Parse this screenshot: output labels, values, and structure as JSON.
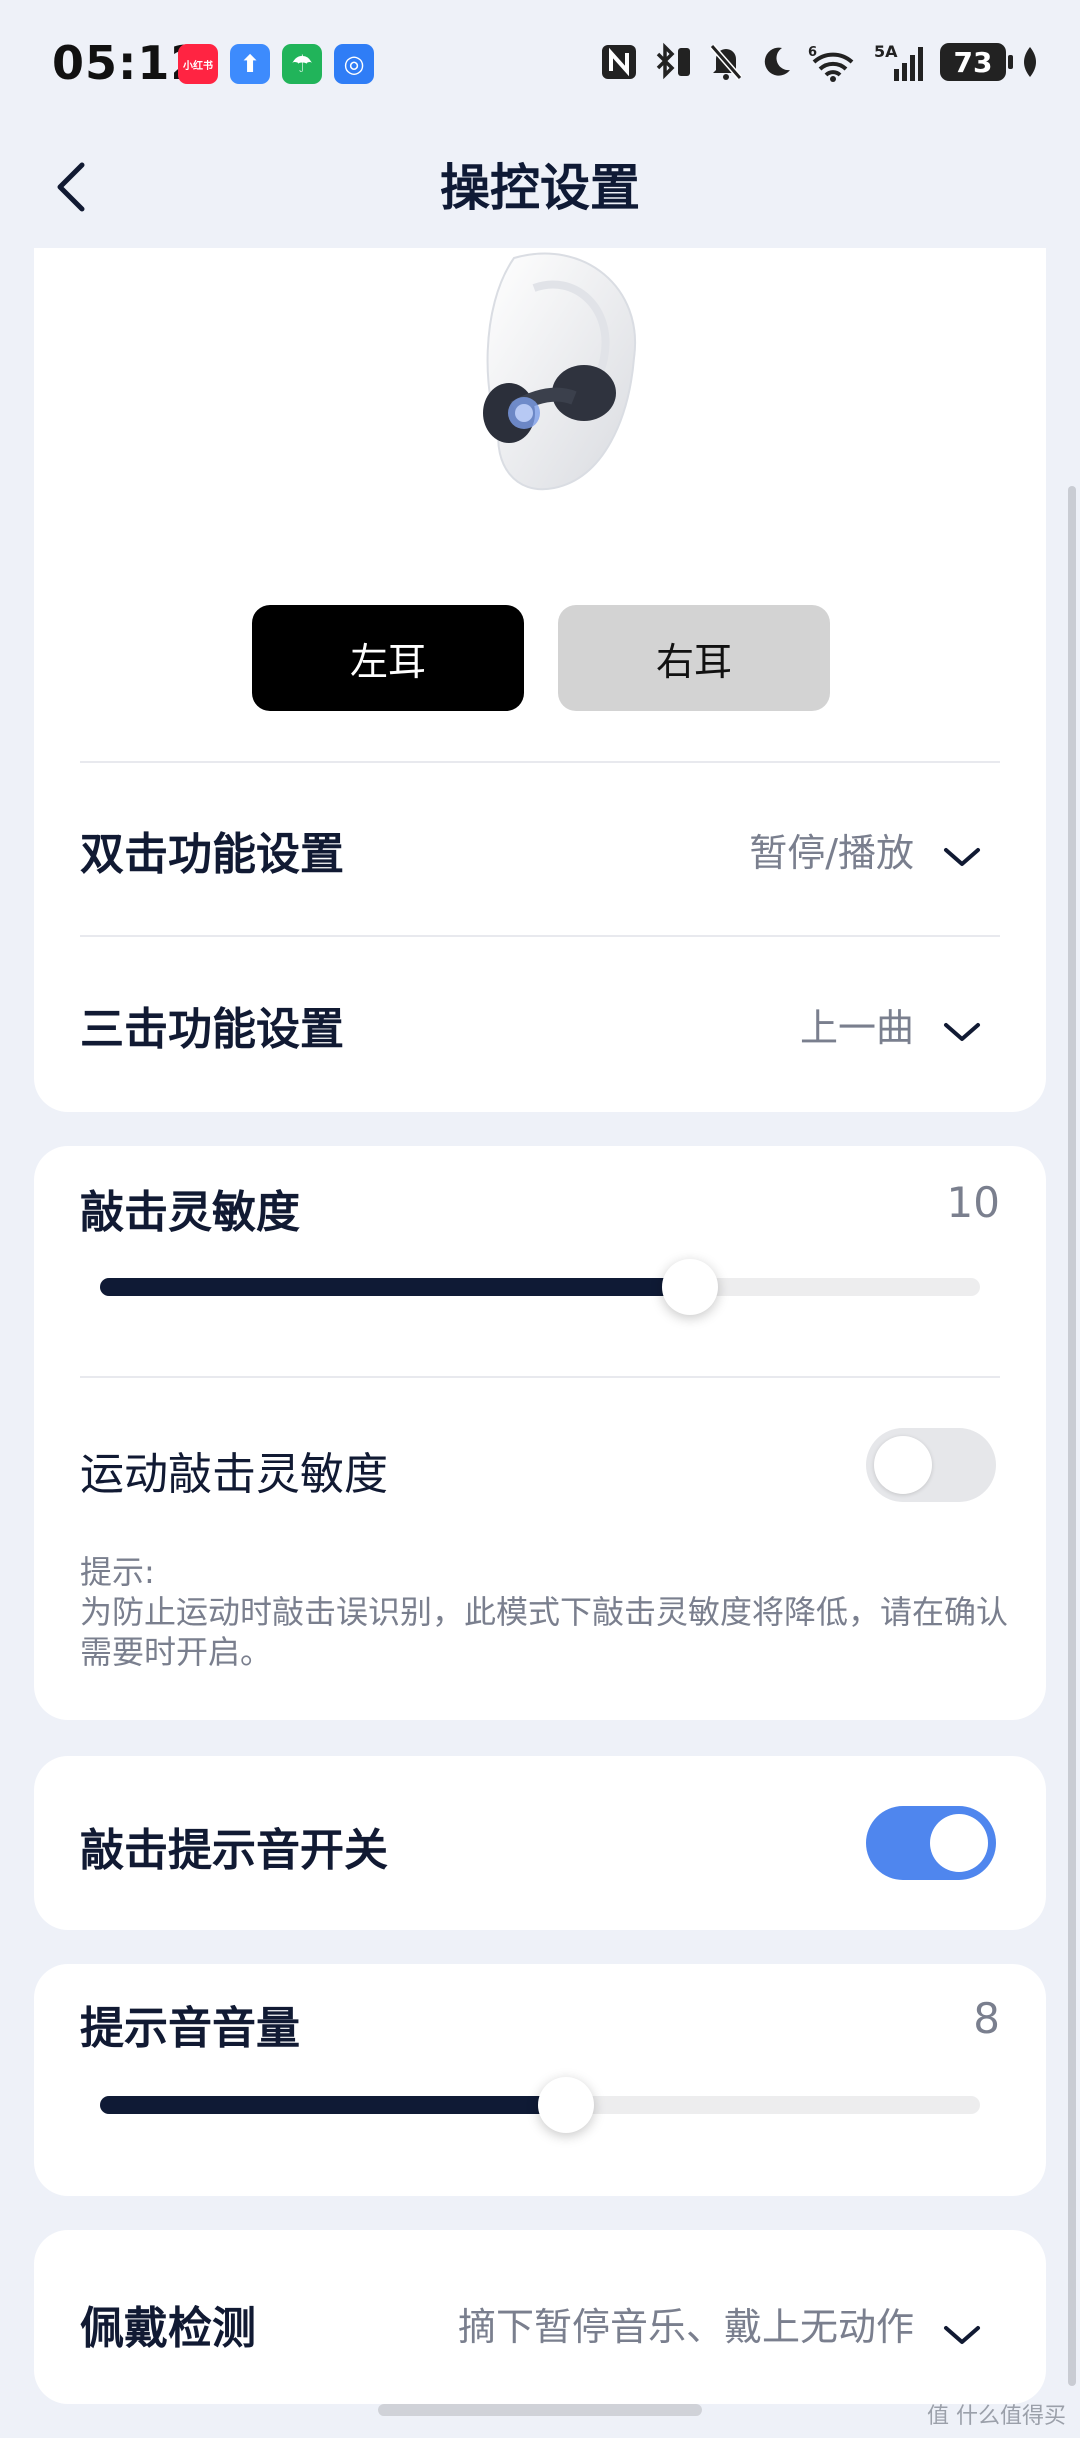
{
  "status_bar": {
    "time": "05:12",
    "app_icons": [
      {
        "name": "xiaohongshu-app-icon",
        "label": "小红书",
        "color": "#ff2442"
      },
      {
        "name": "upload-app-icon",
        "label": "⬆",
        "color": "#3d8bfd"
      },
      {
        "name": "umbrella-app-icon",
        "label": "☂",
        "color": "#21b45a"
      },
      {
        "name": "chat-app-icon",
        "label": "◎",
        "color": "#2f7df6"
      }
    ],
    "network_label": "5A",
    "battery": "73"
  },
  "header": {
    "title": "操控设置"
  },
  "ear_select": {
    "left_label": "左耳",
    "right_label": "右耳",
    "selected": "left"
  },
  "double_tap": {
    "title": "双击功能设置",
    "value": "暂停/播放"
  },
  "triple_tap": {
    "title": "三击功能设置",
    "value": "上一曲"
  },
  "tap_sensitivity": {
    "title": "敲击灵敏度",
    "value": "10",
    "fill_fraction": 0.67
  },
  "sport_sensitivity": {
    "title": "运动敲击灵敏度",
    "enabled": false,
    "hint_title": "提示:",
    "hint_body": "为防止运动时敲击误识别，此模式下敲击灵敏度将降低，请在确认需要时开启。"
  },
  "tap_sound": {
    "title": "敲击提示音开关",
    "enabled": true
  },
  "sound_volume": {
    "title": "提示音音量",
    "value": "8",
    "fill_fraction": 0.53
  },
  "wear_detection": {
    "title": "佩戴检测",
    "value": "摘下暂停音乐、戴上无动作"
  },
  "watermark": "值 什么值得买",
  "colors": {
    "accent": "#4f86ee",
    "dark": "#0f1a35",
    "background": "#eef1f8"
  }
}
